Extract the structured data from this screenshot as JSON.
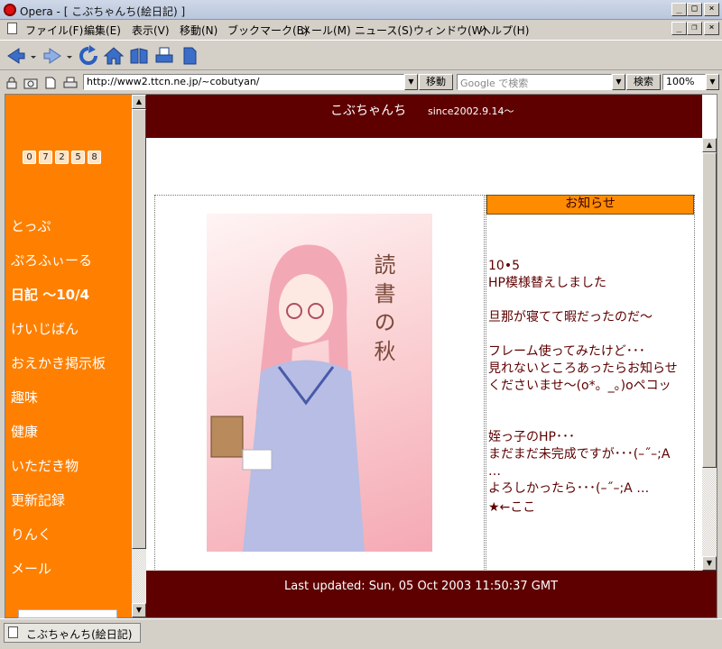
{
  "window": {
    "title": "Opera - [ こぶちゃんち(絵日記) ]"
  },
  "menu": [
    "ファイル(F)",
    "編集(E)",
    "表示(V)",
    "移動(N)",
    "ブックマーク(B)",
    "メール(M)",
    "ニュース(S)",
    "ウィンドウ(W)",
    "ヘルプ(H)"
  ],
  "address": {
    "url": "http://www2.ttcn.ne.jp/~cobutyan/",
    "go_label": "移動"
  },
  "search": {
    "placeholder": "Google で検索",
    "button_label": "検索"
  },
  "zoom": "100%",
  "sidebar": {
    "counter": [
      "0",
      "7",
      "2",
      "5",
      "8"
    ],
    "items": [
      "とっぷ",
      "ぷろふぃーる",
      "日記 〜10/4",
      "けいじばん",
      "おえかき掲示板",
      "趣味",
      "健康",
      "いただき物",
      "更新記録",
      "りんく",
      "メール"
    ]
  },
  "page": {
    "title": "こぶちゃんち",
    "since": "since2002.9.14〜",
    "picture_caption": "読書の秋",
    "notice_heading": "お知らせ",
    "notice_body": "10•5\nHP模様替えしました\n\n旦那が寝てて暇だったのだ〜\n\nフレーム使ってみたけど･･･\n見れないところあったらお知らせ\nくださいませ〜(o*。_。)oペコッ\n\n\n姪っ子のHP･･･\nまだまだ未完成ですが･･･(–˝–;A\n…\nよろしかったら･･･(–˝–;A …",
    "star_link": "★←ここ",
    "footer": "Last updated: Sun, 05 Oct 2003 11:50:37 GMT"
  },
  "status": {
    "tab_title": "こぶちゃんち(絵日記)"
  }
}
